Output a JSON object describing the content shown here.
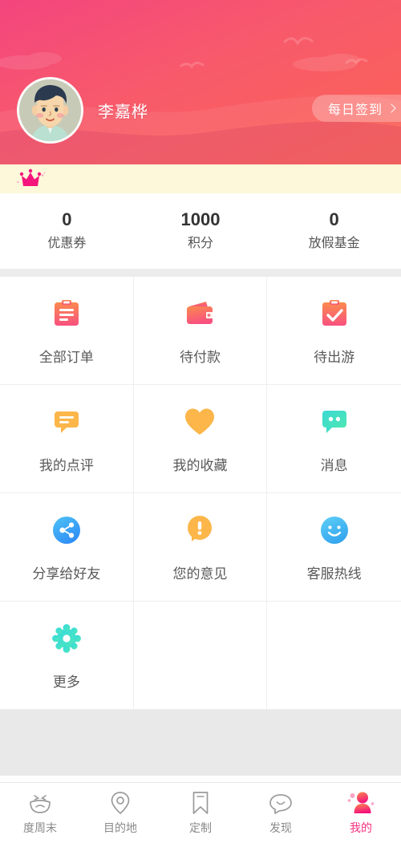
{
  "header": {
    "username": "李嘉桦",
    "checkin_label": "每日签到",
    "checkin_chevron_icon": "chevron-right-icon",
    "avatar_icon": "user-avatar",
    "bird_icon": "bird-silhouette",
    "gradient_from": "#f3457e",
    "gradient_to": "#fb6352"
  },
  "crown_banner": {
    "icon": "crown-icon",
    "icon_color": "#f5157c",
    "background": "#fdf8da"
  },
  "stats": [
    {
      "value": "0",
      "label": "优惠券"
    },
    {
      "value": "1000",
      "label": "积分"
    },
    {
      "value": "0",
      "label": "放假基金"
    }
  ],
  "grid": [
    {
      "label": "全部订单",
      "icon": "clipboard-list-icon",
      "color": "#fa7a50"
    },
    {
      "label": "待付款",
      "icon": "wallet-icon",
      "color": "#fa7a50"
    },
    {
      "label": "待出游",
      "icon": "clipboard-check-icon",
      "color": "#fa7a50"
    },
    {
      "label": "我的点评",
      "icon": "comment-lines-icon",
      "color": "#fcb649"
    },
    {
      "label": "我的收藏",
      "icon": "heart-icon",
      "color": "#fcb649"
    },
    {
      "label": "消息",
      "icon": "message-dots-icon",
      "color": "#3ad9c8"
    },
    {
      "label": "分享给好友",
      "icon": "share-circle-icon",
      "color": "#41a9f5"
    },
    {
      "label": "您的意见",
      "icon": "feedback-alert-icon",
      "color": "#fcb649"
    },
    {
      "label": "客服热线",
      "icon": "smiley-circle-icon",
      "color": "#41b8f0"
    },
    {
      "label": "更多",
      "icon": "gear-icon",
      "color": "#3ad9c8"
    },
    {
      "label": "",
      "icon": "",
      "color": ""
    },
    {
      "label": "",
      "icon": "",
      "color": ""
    }
  ],
  "tabbar": {
    "active_color": "#f5317f",
    "inactive_color": "#8a8a8a",
    "items": [
      {
        "label": "度周末",
        "icon": "smiling-face-icon",
        "active": false
      },
      {
        "label": "目的地",
        "icon": "location-pin-icon",
        "active": false
      },
      {
        "label": "定制",
        "icon": "bookmark-icon",
        "active": false
      },
      {
        "label": "发现",
        "icon": "chat-smile-icon",
        "active": false
      },
      {
        "label": "我的",
        "icon": "person-icon",
        "active": true
      }
    ]
  }
}
